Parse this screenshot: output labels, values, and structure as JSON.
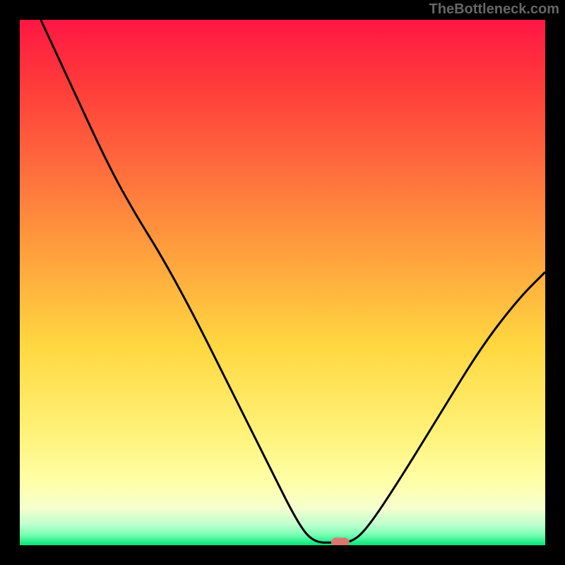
{
  "watermark": "TheBottleneck.com",
  "chart_data": {
    "type": "line",
    "title": "",
    "xlabel": "",
    "ylabel": "",
    "xlim": [
      0,
      100
    ],
    "ylim": [
      0,
      100
    ],
    "gradient": {
      "top_color": "#ff1744",
      "mid_color": "#ffd740",
      "bottom_band_color": "#ffffa8",
      "bottom_edge_color": "#00e676"
    },
    "curve_points": [
      {
        "x": 4,
        "y": 100
      },
      {
        "x": 10,
        "y": 87
      },
      {
        "x": 17,
        "y": 72
      },
      {
        "x": 22,
        "y": 63
      },
      {
        "x": 27,
        "y": 55
      },
      {
        "x": 33,
        "y": 44
      },
      {
        "x": 40,
        "y": 30
      },
      {
        "x": 47,
        "y": 16
      },
      {
        "x": 53,
        "y": 4
      },
      {
        "x": 56,
        "y": 0.5
      },
      {
        "x": 60,
        "y": 0.5
      },
      {
        "x": 63,
        "y": 0.5
      },
      {
        "x": 66,
        "y": 3
      },
      {
        "x": 72,
        "y": 12
      },
      {
        "x": 80,
        "y": 25
      },
      {
        "x": 88,
        "y": 38
      },
      {
        "x": 95,
        "y": 47
      },
      {
        "x": 100,
        "y": 52
      }
    ],
    "marker": {
      "x": 61,
      "y": 0.5,
      "color": "#d9776e"
    }
  }
}
